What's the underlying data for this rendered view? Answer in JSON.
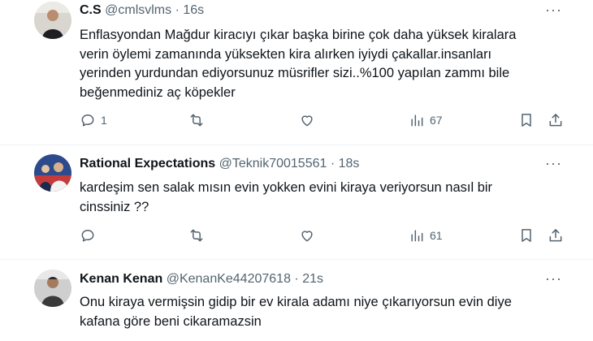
{
  "tweets": [
    {
      "name": "C.S",
      "handle": "@cmlsvlms",
      "separator": "·",
      "time": "16s",
      "text": "Enflasyondan Mağdur kiracıyı çıkar başka birine çok daha yüksek kiralara\nverin öylemi zamanında yüksekten kira alırken iyiydi çakallar.insanları\nyerinden yurdundan ediyorsunuz müsrifler sizi..%100 yapılan zammı bile\nbeğenmediniz aç köpekler",
      "replies": "1",
      "views": "67",
      "more": "···"
    },
    {
      "name": "Rational Expectations",
      "handle": "@Teknik70015561",
      "separator": "·",
      "time": "18s",
      "text": "kardeşim sen salak mısın evin yokken evini kiraya veriyorsun nasıl bir\ncinssiniz ??",
      "replies": "",
      "views": "61",
      "more": "···"
    },
    {
      "name": "Kenan Kenan",
      "handle": "@KenanKe44207618",
      "separator": "·",
      "time": "21s",
      "text": "Onu kiraya vermişsin gidip bir ev kirala adamı niye çıkarıyorsun evin diye\nkafana göre beni cikaramazsin",
      "more": "···"
    }
  ],
  "icons": {
    "reply": "reply-icon",
    "retweet": "retweet-icon",
    "like": "like-icon",
    "views": "views-icon",
    "bookmark": "bookmark-icon",
    "share": "share-icon"
  },
  "colors": {
    "text": "#0f1419",
    "secondary": "#536471",
    "divider": "#eff3f4"
  }
}
